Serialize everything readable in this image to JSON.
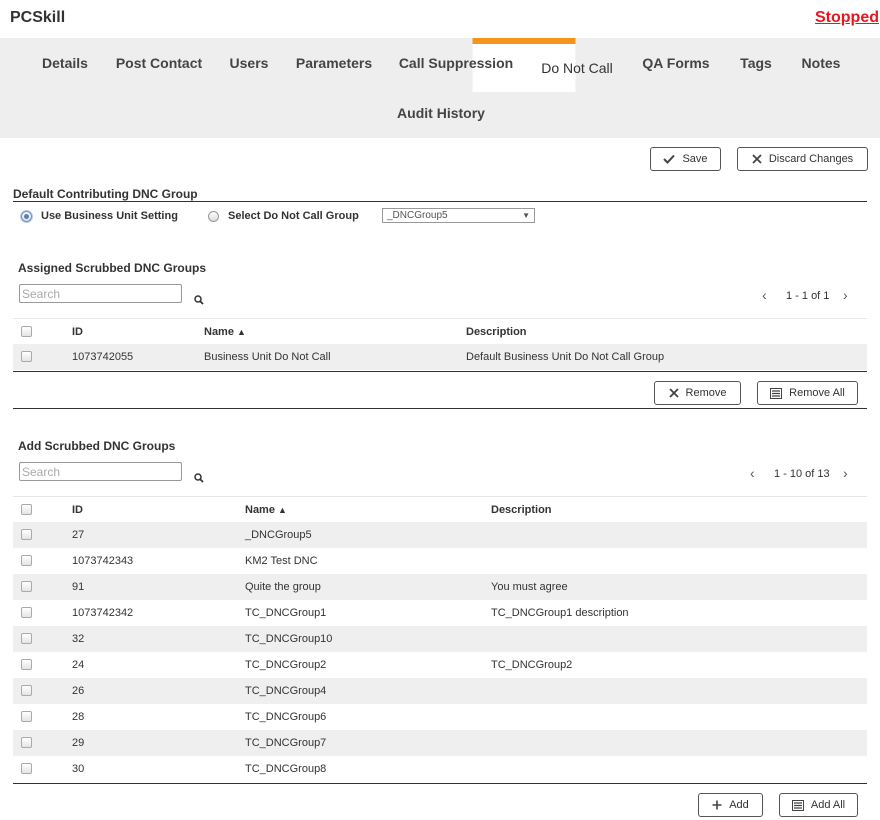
{
  "header": {
    "title": "PCSkill",
    "status": "Stopped"
  },
  "tabs": [
    {
      "label": "Details"
    },
    {
      "label": "Post Contact"
    },
    {
      "label": "Users"
    },
    {
      "label": "Parameters"
    },
    {
      "label": "Call Suppression"
    },
    {
      "label": "Do Not Call"
    },
    {
      "label": "QA Forms"
    },
    {
      "label": "Tags"
    },
    {
      "label": "Notes"
    },
    {
      "label": "Audit History"
    }
  ],
  "active_tab": "Do Not Call",
  "toolbar": {
    "save_label": "Save",
    "discard_label": "Discard Changes"
  },
  "default_group": {
    "title": "Default Contributing DNC Group",
    "option_bu": "Use Business Unit Setting",
    "option_select": "Select Do Not Call Group",
    "selected_option": "Use Business Unit Setting",
    "dropdown_value": "_DNCGroup5"
  },
  "assigned": {
    "title": "Assigned Scrubbed DNC Groups",
    "search_placeholder": "Search",
    "pager": "1 - 1 of 1",
    "columns": {
      "id": "ID",
      "name": "Name",
      "description": "Description"
    },
    "rows": [
      {
        "id": "1073742055",
        "name": "Business Unit Do Not Call",
        "description": "Default Business Unit Do Not Call Group"
      }
    ],
    "remove_label": "Remove",
    "remove_all_label": "Remove All"
  },
  "available": {
    "title": "Add Scrubbed DNC Groups",
    "search_placeholder": "Search",
    "pager": "1 - 10 of 13",
    "columns": {
      "id": "ID",
      "name": "Name",
      "description": "Description"
    },
    "rows": [
      {
        "id": "27",
        "name": "_DNCGroup5",
        "description": ""
      },
      {
        "id": "1073742343",
        "name": "KM2 Test DNC",
        "description": ""
      },
      {
        "id": "91",
        "name": "Quite the group",
        "description": "You must agree"
      },
      {
        "id": "1073742342",
        "name": "TC_DNCGroup1",
        "description": "TC_DNCGroup1 description"
      },
      {
        "id": "32",
        "name": "TC_DNCGroup10",
        "description": ""
      },
      {
        "id": "24",
        "name": "TC_DNCGroup2",
        "description": "TC_DNCGroup2"
      },
      {
        "id": "26",
        "name": "TC_DNCGroup4",
        "description": ""
      },
      {
        "id": "28",
        "name": "TC_DNCGroup6",
        "description": ""
      },
      {
        "id": "29",
        "name": "TC_DNCGroup7",
        "description": ""
      },
      {
        "id": "30",
        "name": "TC_DNCGroup8",
        "description": ""
      }
    ],
    "add_label": "Add",
    "add_all_label": "Add All"
  },
  "colors": {
    "accent": "#f7941d",
    "status": "#e8171f",
    "tabbar": "#eeeeee",
    "row_alt": "#efefef"
  }
}
